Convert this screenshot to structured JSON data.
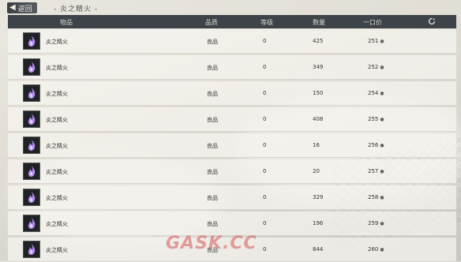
{
  "topbar": {
    "back_label": "返回",
    "breadcrumb": "- 炎之精火 -"
  },
  "table": {
    "columns": {
      "item": "物品",
      "quality": "品质",
      "level": "等级",
      "quantity": "数量",
      "unit_price": "一口价"
    },
    "rows": [
      {
        "name": "炎之精火",
        "quality": "良品",
        "level": "0",
        "quantity": "425",
        "price": "251"
      },
      {
        "name": "炎之精火",
        "quality": "良品",
        "level": "0",
        "quantity": "349",
        "price": "252"
      },
      {
        "name": "炎之精火",
        "quality": "良品",
        "level": "0",
        "quantity": "150",
        "price": "254"
      },
      {
        "name": "炎之精火",
        "quality": "良品",
        "level": "0",
        "quantity": "408",
        "price": "255"
      },
      {
        "name": "炎之精火",
        "quality": "良品",
        "level": "0",
        "quantity": "16",
        "price": "256"
      },
      {
        "name": "炎之精火",
        "quality": "良品",
        "level": "0",
        "quantity": "20",
        "price": "257"
      },
      {
        "name": "炎之精火",
        "quality": "良品",
        "level": "0",
        "quantity": "329",
        "price": "258"
      },
      {
        "name": "炎之精火",
        "quality": "良品",
        "level": "0",
        "quantity": "196",
        "price": "259"
      },
      {
        "name": "炎之精火",
        "quality": "良品",
        "level": "0",
        "quantity": "844",
        "price": "260"
      }
    ]
  },
  "watermark": "GASK.CC",
  "icons": {
    "item": "purple-flame-icon",
    "refresh": "refresh-icon",
    "back": "chevron-left-icon",
    "coin": "coin-icon"
  },
  "colors": {
    "header_bg": "#3d4348",
    "flame": "#b58cf0"
  }
}
